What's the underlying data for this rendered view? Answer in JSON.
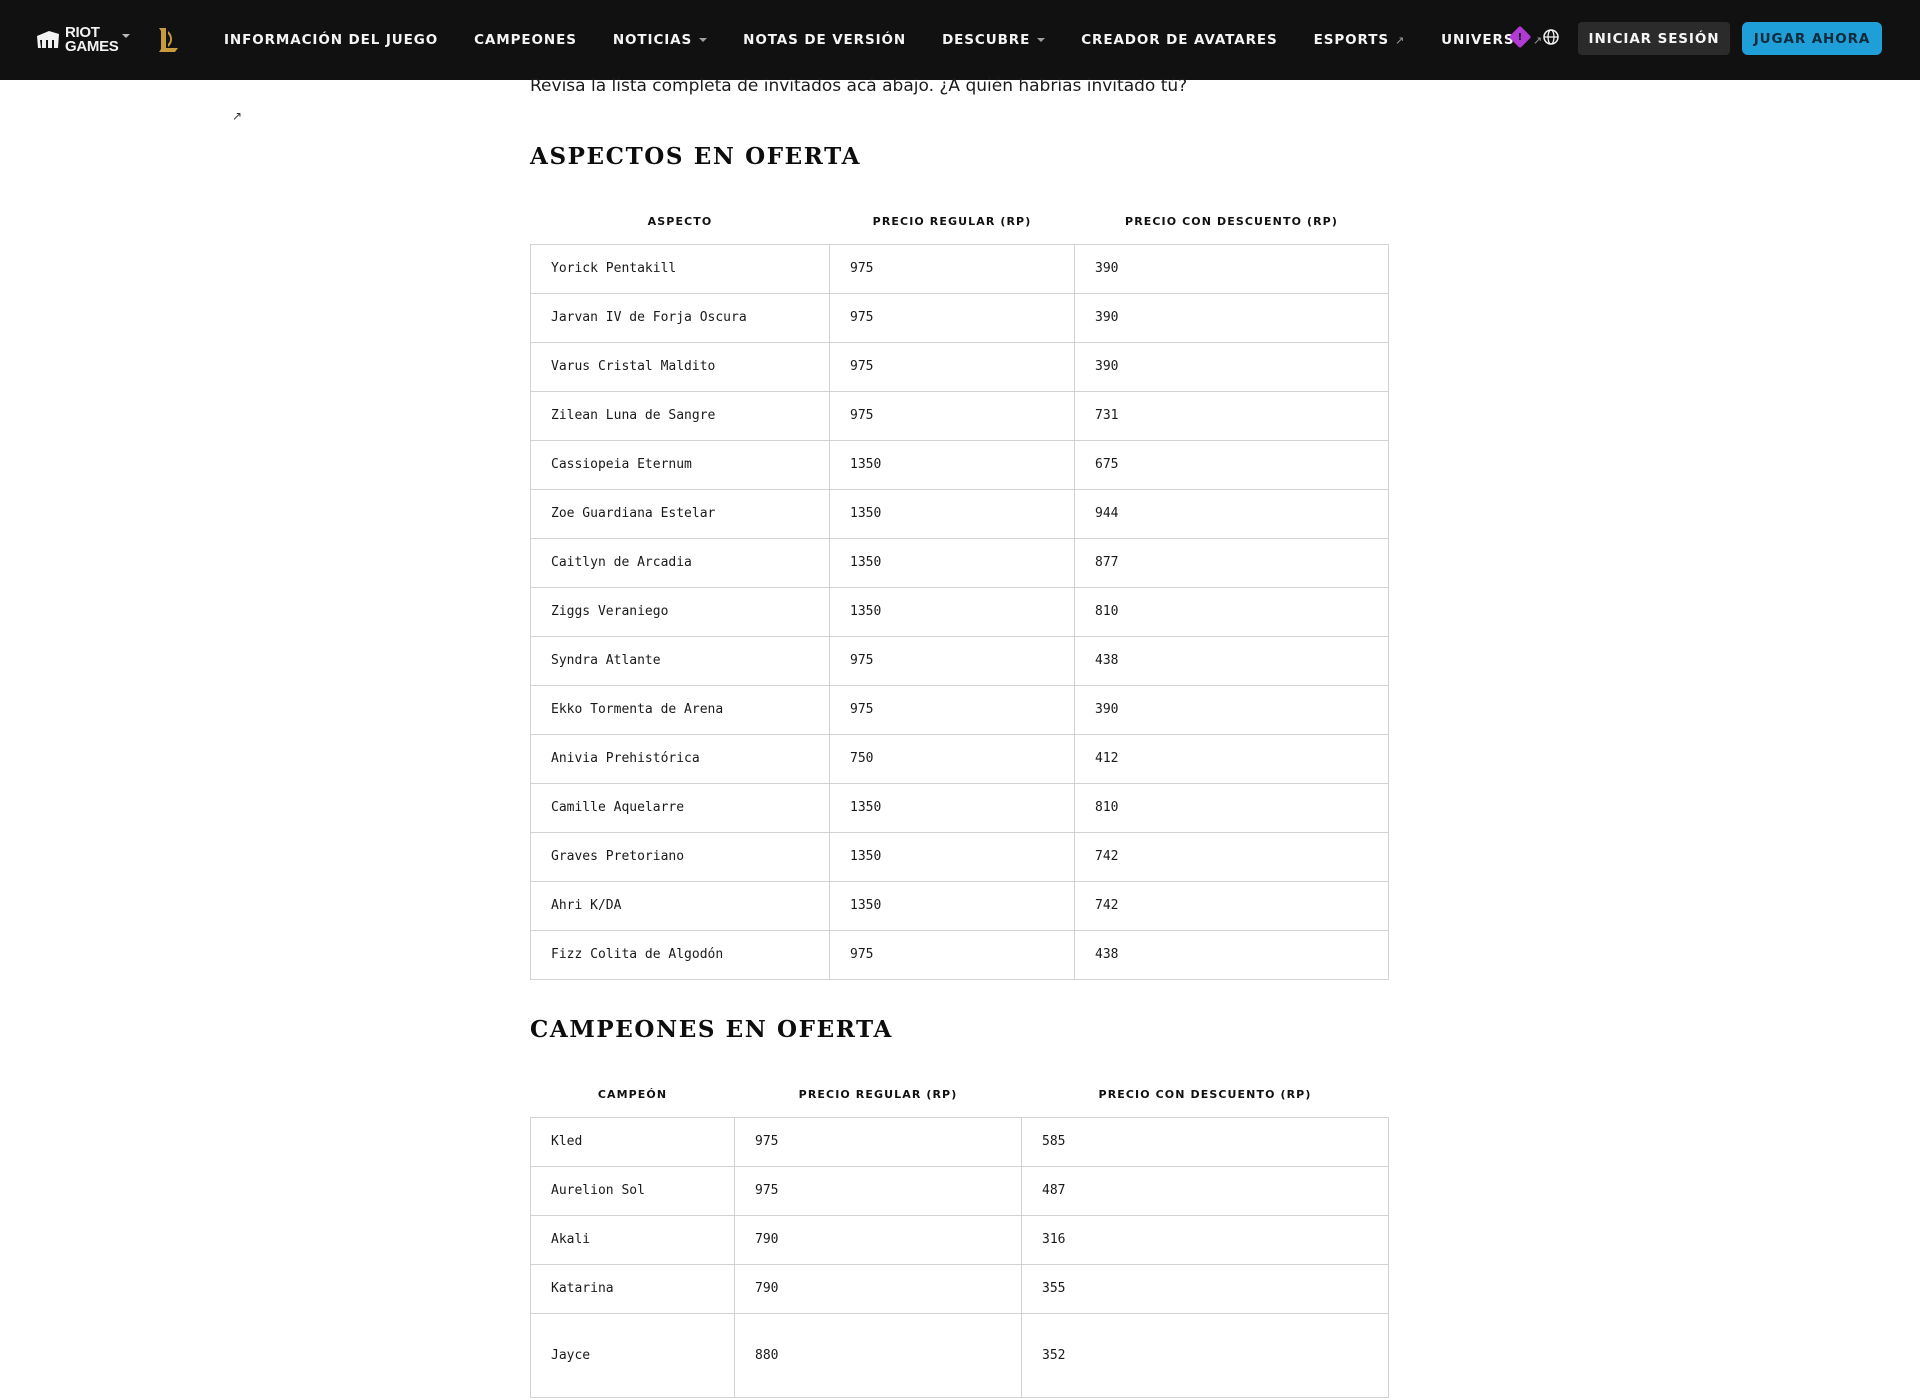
{
  "header": {
    "riot_logo_text": [
      "RIOT",
      "GAMES"
    ],
    "nav": [
      {
        "label": "INFORMACIÓN DEL JUEGO",
        "caret": false,
        "external": false
      },
      {
        "label": "CAMPEONES",
        "caret": false,
        "external": false
      },
      {
        "label": "NOTICIAS",
        "caret": true,
        "external": false
      },
      {
        "label": "NOTAS DE VERSIÓN",
        "caret": false,
        "external": false
      },
      {
        "label": "DESCUBRE",
        "caret": true,
        "external": false
      },
      {
        "label": "CREADOR DE AVATARES",
        "caret": false,
        "external": false
      },
      {
        "label": "ESPORTS",
        "caret": false,
        "external": true
      },
      {
        "label": "UNIVERSO",
        "caret": false,
        "external": true
      }
    ],
    "alert_glyph": "!",
    "login_label": "INICIAR SESIÓN",
    "play_label": "JUGAR AHORA",
    "colors": {
      "bar": "#111111",
      "play_button": "#1e9fd8",
      "login_button": "#2b2b2b",
      "alert": "#b03ad3",
      "lol_gold": "#c89b3c"
    }
  },
  "side": {
    "external_link_icon": "arrow-up-right-icon"
  },
  "article": {
    "intro": "Revisa la lista completa de invitados acá abajo. ¿A quién habrías invitado tú?",
    "skins_section": {
      "title": "ASPECTOS EN OFERTA",
      "columns": [
        "ASPECTO",
        "PRECIO REGULAR (RP)",
        "PRECIO CON DESCUENTO (RP)"
      ],
      "rows": [
        [
          "Yorick Pentakill",
          "975",
          "390"
        ],
        [
          "Jarvan IV de Forja Oscura",
          "975",
          "390"
        ],
        [
          "Varus Cristal Maldito",
          "975",
          "390"
        ],
        [
          "Zilean Luna de Sangre",
          "975",
          "731"
        ],
        [
          "Cassiopeia Eternum",
          "1350",
          "675"
        ],
        [
          "Zoe Guardiana Estelar",
          "1350",
          "944"
        ],
        [
          "Caitlyn de Arcadia",
          "1350",
          "877"
        ],
        [
          "Ziggs Veraniego",
          "1350",
          "810"
        ],
        [
          "Syndra Atlante",
          "975",
          "438"
        ],
        [
          "Ekko Tormenta de Arena",
          "975",
          "390"
        ],
        [
          "Anivia Prehistórica",
          "750",
          "412"
        ],
        [
          "Camille Aquelarre",
          "1350",
          "810"
        ],
        [
          "Graves Pretoriano",
          "1350",
          "742"
        ],
        [
          "Ahri K/DA",
          "1350",
          "742"
        ],
        [
          "Fizz Colita de Algodón",
          "975",
          "438"
        ]
      ]
    },
    "champions_section": {
      "title": "CAMPEONES EN OFERTA",
      "columns": [
        "CAMPEÓN",
        "PRECIO REGULAR (RP)",
        "PRECIO CON DESCUENTO (RP)"
      ],
      "rows": [
        [
          "Kled",
          "975",
          "585"
        ],
        [
          "Aurelion Sol",
          "975",
          "487"
        ],
        [
          "Akali",
          "790",
          "316"
        ],
        [
          "Katarina",
          "790",
          "355"
        ],
        [
          "Jayce",
          "880",
          "352"
        ]
      ]
    }
  }
}
